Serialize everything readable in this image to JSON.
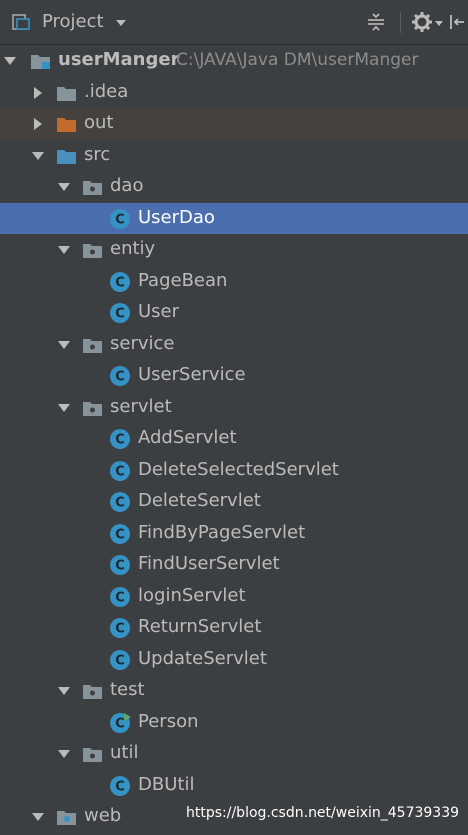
{
  "header": {
    "title": "Project"
  },
  "tree": {
    "root": {
      "name": "userManger",
      "path": "C:\\JAVA\\Java DM\\userManger"
    },
    "idea": ".idea",
    "out": "out",
    "src": "src",
    "dao": "dao",
    "userdao": "UserDao",
    "entiy": "entiy",
    "pagebean": "PageBean",
    "user": "User",
    "service": "service",
    "userservice": "UserService",
    "servlet": "servlet",
    "addservlet": "AddServlet",
    "deleteselectedservlet": "DeleteSelectedServlet",
    "deleteservlet": "DeleteServlet",
    "findbypageservlet": "FindByPageServlet",
    "finduserservlet": "FindUserServlet",
    "loginservlet": "loginServlet",
    "returnservlet": "ReturnServlet",
    "updateservlet": "UpdateServlet",
    "test": "test",
    "person": "Person",
    "util": "util",
    "dbutil": "DBUtil",
    "web": "web"
  },
  "watermark": "https://blog.csdn.net/weixin_45739339",
  "colors": {
    "background": "#3c3f41",
    "selection": "#4b6eaf",
    "class_icon": "#3592c4",
    "folder": "#87939a",
    "out_folder": "#c46a2c",
    "src_folder": "#4a90bf"
  }
}
